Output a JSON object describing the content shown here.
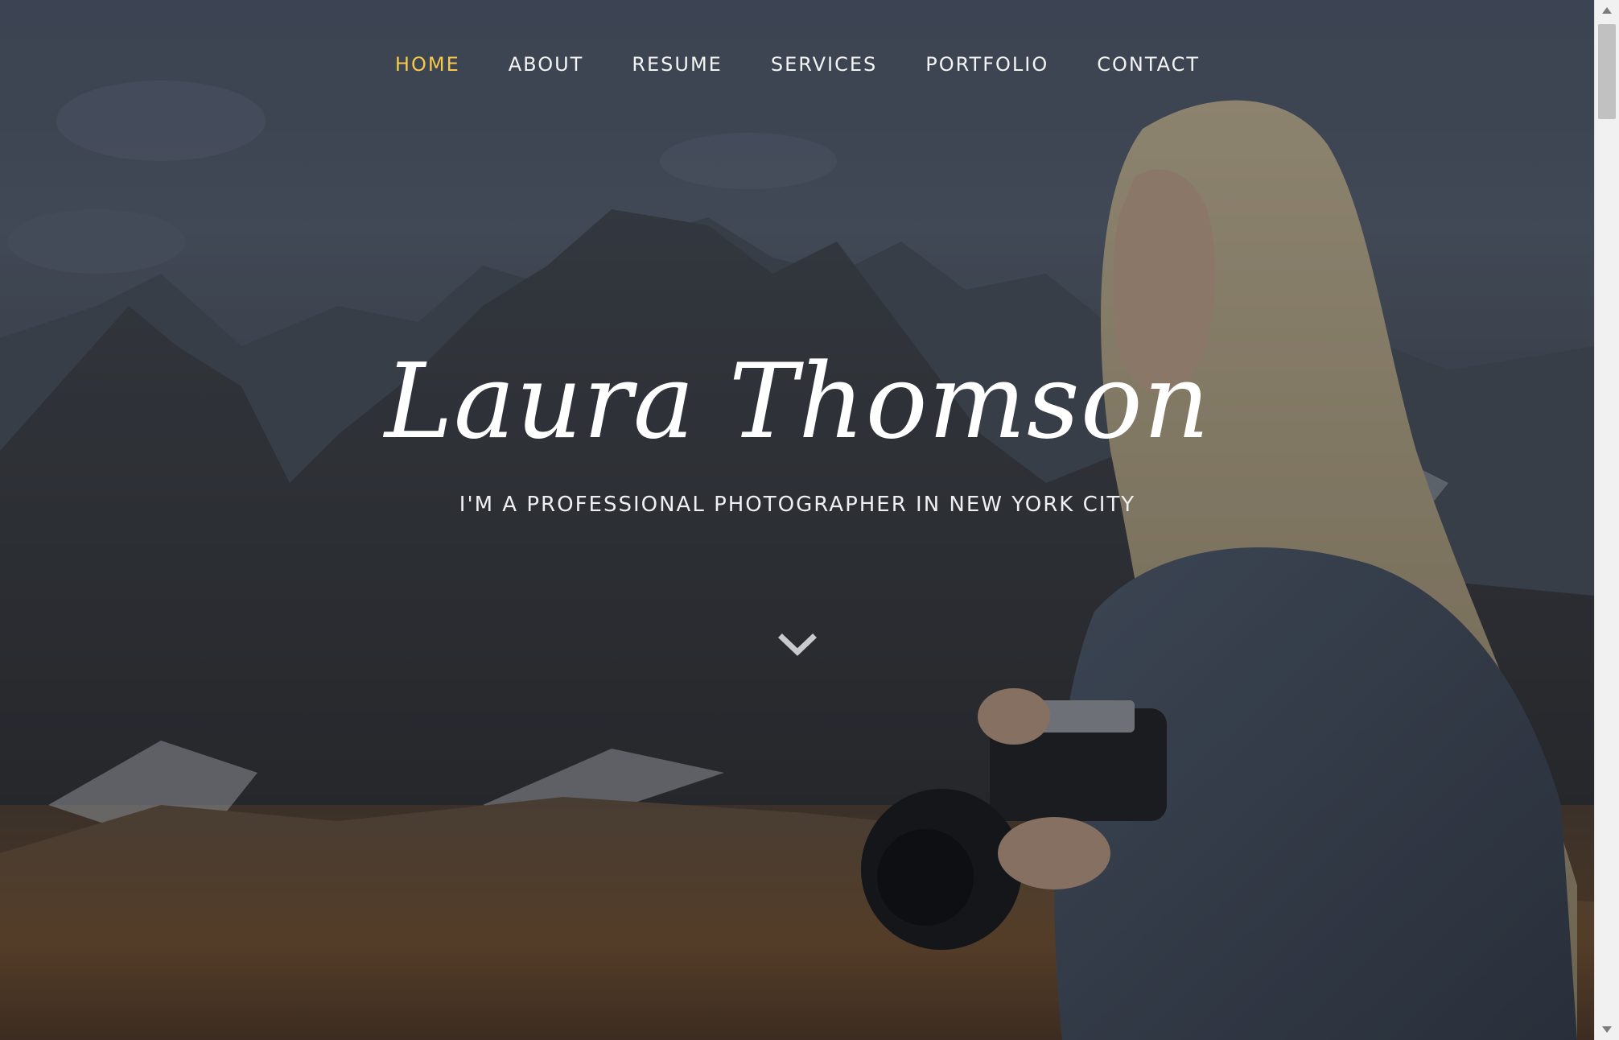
{
  "nav": {
    "items": [
      {
        "label": "HOME",
        "active": true
      },
      {
        "label": "ABOUT",
        "active": false
      },
      {
        "label": "RESUME",
        "active": false
      },
      {
        "label": "SERVICES",
        "active": false
      },
      {
        "label": "PORTFOLIO",
        "active": false
      },
      {
        "label": "CONTACT",
        "active": false
      }
    ]
  },
  "hero": {
    "name": "Laura Thomson",
    "tagline": "I'M A PROFESSIONAL PHOTOGRAPHER IN NEW YORK CITY",
    "scroll_icon": "chevron-down-icon"
  },
  "colors": {
    "accent": "#f6c948",
    "nav_text": "#f4f4f4",
    "overlay": "#2a2e36"
  }
}
